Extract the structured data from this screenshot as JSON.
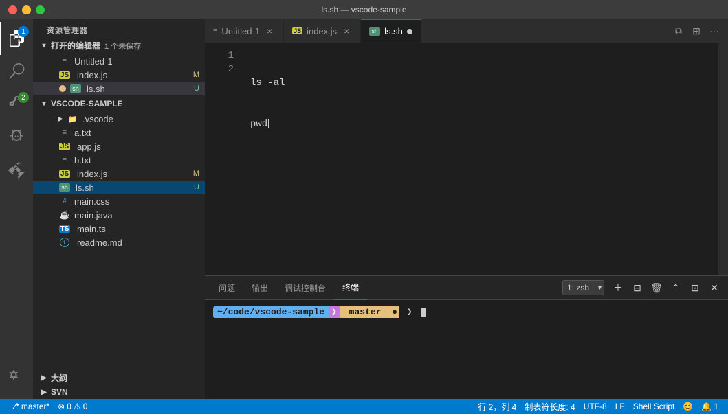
{
  "titlebar": {
    "title": "ls.sh — vscode-sample"
  },
  "activity": {
    "icons": [
      {
        "name": "files-icon",
        "label": "Explorer",
        "active": true,
        "badge": "1"
      },
      {
        "name": "search-icon",
        "label": "Search",
        "active": false
      },
      {
        "name": "git-icon",
        "label": "Source Control",
        "active": false,
        "badge": "2"
      },
      {
        "name": "debug-icon",
        "label": "Run and Debug",
        "active": false
      },
      {
        "name": "extensions-icon",
        "label": "Extensions",
        "active": false
      }
    ],
    "bottom": [
      {
        "name": "settings-icon",
        "label": "Settings"
      }
    ]
  },
  "sidebar": {
    "title": "资源管理器",
    "open_editors": {
      "label": "打开的编辑器",
      "badge": "1 个未保存",
      "items": [
        {
          "name": "Untitled-1",
          "type": "untitled",
          "badge": ""
        },
        {
          "name": "index.js",
          "type": "js",
          "badge": "M"
        },
        {
          "name": "ls.sh",
          "type": "sh",
          "badge": "U",
          "active": true
        }
      ]
    },
    "project": {
      "label": "VSCODE-SAMPLE",
      "items": [
        {
          "name": ".vscode",
          "type": "folder"
        },
        {
          "name": "a.txt",
          "type": "txt"
        },
        {
          "name": "app.js",
          "type": "js"
        },
        {
          "name": "b.txt",
          "type": "txt"
        },
        {
          "name": "index.js",
          "type": "js",
          "badge": "M"
        },
        {
          "name": "ls.sh",
          "type": "sh",
          "badge": "U",
          "active": true
        },
        {
          "name": "main.css",
          "type": "css"
        },
        {
          "name": "main.java",
          "type": "java"
        },
        {
          "name": "main.ts",
          "type": "ts"
        },
        {
          "name": "readme.md",
          "type": "md"
        }
      ]
    },
    "outline": {
      "label": "大纲"
    },
    "svn": {
      "label": "SVN"
    }
  },
  "tabs": [
    {
      "label": "Untitled-1",
      "type": "untitled",
      "active": false
    },
    {
      "label": "index.js",
      "type": "js",
      "active": false
    },
    {
      "label": "ls.sh",
      "type": "sh",
      "active": true,
      "dirty": true
    }
  ],
  "editor": {
    "lines": [
      {
        "num": "1",
        "code": "ls -al"
      },
      {
        "num": "2",
        "code": "pwd"
      }
    ]
  },
  "terminal": {
    "tabs": [
      "问题",
      "输出",
      "调试控制台",
      "终端"
    ],
    "active_tab": "终端",
    "shell": "1: zsh",
    "prompt": {
      "path": "~/code/vscode-sample",
      "branch": "master",
      "cursor": ""
    }
  },
  "statusbar": {
    "branch": "master*",
    "errors": "0",
    "warnings": "0",
    "position": "行 2，列 4",
    "tab_size": "制表符长度: 4",
    "encoding": "UTF-8",
    "line_ending": "LF",
    "language": "Shell Script",
    "emoji": "😊",
    "notifications": "1"
  }
}
